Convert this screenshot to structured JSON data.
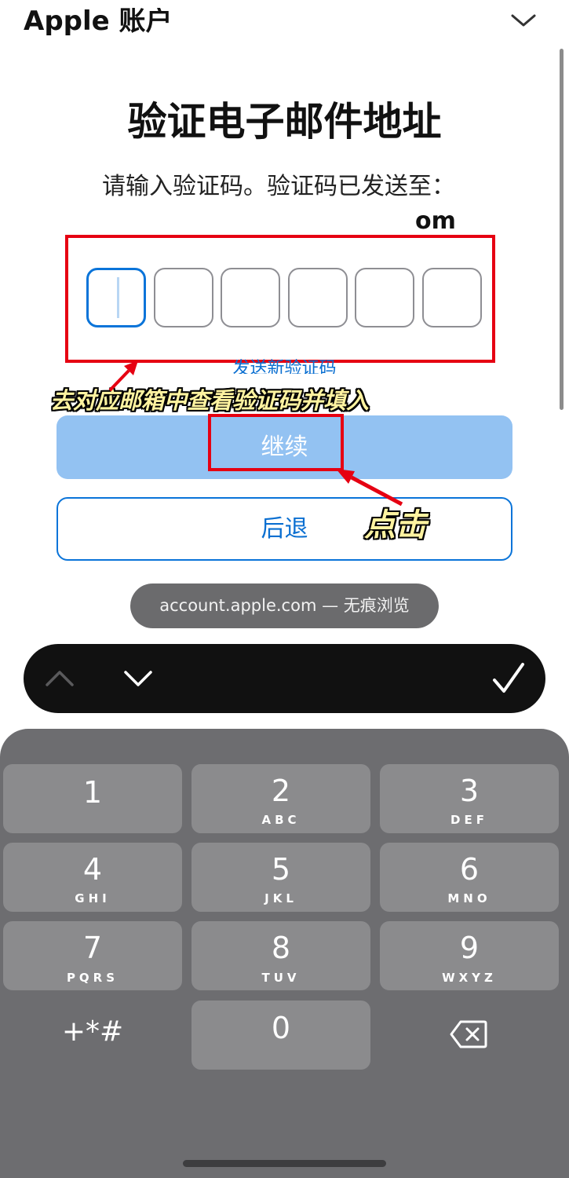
{
  "header": {
    "title": "Apple 账户"
  },
  "page": {
    "title": "验证电子邮件地址",
    "instruction": "请输入验证码。验证码已发送至：",
    "email_suffix": "om",
    "resend_link": "发送新验证码",
    "continue_label": "继续",
    "back_label": "后退"
  },
  "code": {
    "boxes": [
      "",
      "",
      "",
      "",
      "",
      ""
    ]
  },
  "annotations": {
    "code_hint": "去对应邮箱中查看验证码并填入",
    "click_hint": "点击",
    "color": "#e60012"
  },
  "browser": {
    "url_pill": "account.apple.com — 无痕浏览"
  },
  "keyboard": {
    "keys": [
      {
        "digit": "1",
        "letters": ""
      },
      {
        "digit": "2",
        "letters": "ABC"
      },
      {
        "digit": "3",
        "letters": "DEF"
      },
      {
        "digit": "4",
        "letters": "GHI"
      },
      {
        "digit": "5",
        "letters": "JKL"
      },
      {
        "digit": "6",
        "letters": "MNO"
      },
      {
        "digit": "7",
        "letters": "PQRS"
      },
      {
        "digit": "8",
        "letters": "TUV"
      },
      {
        "digit": "9",
        "letters": "WXYZ"
      },
      {
        "digit": "0",
        "letters": ""
      }
    ],
    "symbols_label": "+*#",
    "accessory": {
      "prev_icon": "chevron-up-icon",
      "next_icon": "chevron-down-icon",
      "done_icon": "checkmark-icon"
    },
    "delete_icon": "backspace-icon"
  },
  "colors": {
    "accent": "#0a74d9",
    "continue_bg": "#93c2f2",
    "keyboard_bg": "#6d6d70",
    "key_bg": "#8b8b8d"
  }
}
